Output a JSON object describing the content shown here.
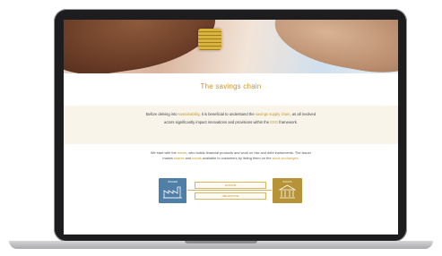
{
  "page": {
    "title": "The savings chain",
    "intro": {
      "p1": "Before delving into ",
      "p1_hl": "sustainability",
      "p2": ", it is beneficial to understand the ",
      "p2_hl": "savings supply chain",
      "p3": ", as all involved actors significantly impact innovations and provisions within the ",
      "p3_hl": "ESG",
      "p4": " framework."
    },
    "body": {
      "p1": "We start with the ",
      "p1_hl": "issuer",
      "p2": ", who builds financial products and work on risk and debt instruments. The issuer makes ",
      "p2_hl": "shares",
      "p3": " and ",
      "p3_hl": "bonds",
      "p4": " available to customers by listing them on the ",
      "p4_hl": "stock exchanges",
      "p5": "."
    },
    "diagram": {
      "issuer_label": "ISSUER",
      "exchange_label": "STOCK",
      "flow_top": "ACTIONS",
      "flow_bottom": "OBLIGATIONS"
    }
  },
  "colors": {
    "accent": "#c7962a",
    "issuer_box": "#4f7ea6",
    "exchange_box": "#b79338",
    "intro_band": "#f8f4ea",
    "device_frame": "#1d1d1f"
  },
  "icons": {
    "issuer": "factory-icon",
    "exchange": "bank-building-icon"
  }
}
